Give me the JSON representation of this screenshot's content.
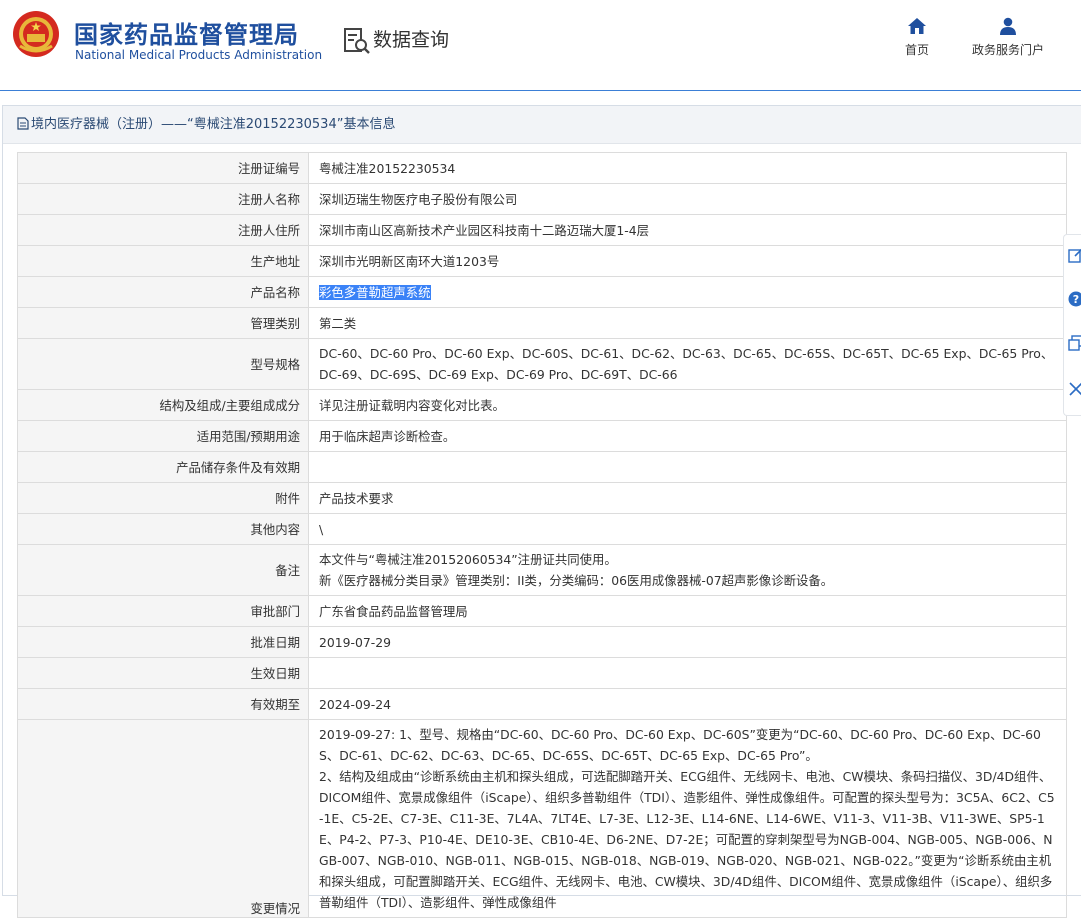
{
  "header": {
    "logo_cn": "国家药品监督管理局",
    "logo_en": "National Medical Products Administration",
    "query_title": "数据查询",
    "nav": [
      {
        "label": "首页",
        "icon": "home-icon"
      },
      {
        "label": "政务服务门户",
        "icon": "user-icon"
      }
    ]
  },
  "breadcrumb": "境内医疗器械（注册）——“粤械注准20152230534”基本信息",
  "rows": [
    {
      "key": "注册证编号",
      "value": "粤械注准20152230534"
    },
    {
      "key": "注册人名称",
      "value": "深圳迈瑞生物医疗电子股份有限公司"
    },
    {
      "key": "注册人住所",
      "value": "深圳市南山区高新技术产业园区科技南十二路迈瑞大厦1-4层"
    },
    {
      "key": "生产地址",
      "value": "深圳市光明新区南环大道1203号"
    },
    {
      "key": "产品名称",
      "value": "彩色多普勒超声系统"
    },
    {
      "key": "管理类别",
      "value": "第二类"
    },
    {
      "key": "型号规格",
      "value": "DC-60、DC-60 Pro、DC-60 Exp、DC-60S、DC-61、DC-62、DC-63、DC-65、DC-65S、DC-65T、DC-65 Exp、DC-65 Pro、DC-69、DC-69S、DC-69 Exp、DC-69 Pro、DC-69T、DC-66"
    },
    {
      "key": "结构及组成/主要组成成分",
      "value": "详见注册证载明内容变化对比表。"
    },
    {
      "key": "适用范围/预期用途",
      "value": "用于临床超声诊断检查。"
    },
    {
      "key": "产品储存条件及有效期",
      "value": ""
    },
    {
      "key": "附件",
      "value": "产品技术要求"
    },
    {
      "key": "其他内容",
      "value": "\\"
    },
    {
      "key": "备注",
      "value_line1": "本文件与“粤械注准20152060534”注册证共同使用。",
      "value_line2": "新《医疗器械分类目录》管理类别：II类，分类编码：06医用成像器械-07超声影像诊断设备。"
    },
    {
      "key": "审批部门",
      "value": "广东省食品药品监督管理局"
    },
    {
      "key": "批准日期",
      "value": "2019-07-29"
    },
    {
      "key": "生效日期",
      "value": ""
    },
    {
      "key": "有效期至",
      "value": "2024-09-24"
    },
    {
      "key": "变更情况",
      "value_line1": "2019-09-27: 1、型号、规格由“DC-60、DC-60 Pro、DC-60 Exp、DC-60S”变更为“DC-60、DC-60 Pro、DC-60 Exp、DC-60S、DC-61、DC-62、DC-63、DC-65、DC-65S、DC-65T、DC-65 Exp、DC-65 Pro”。",
      "value_line2": "2、结构及组成由“诊断系统由主机和探头组成，可选配脚踏开关、ECG组件、无线网卡、电池、CW模块、条码扫描仪、3D/4D组件、DICOM组件、宽景成像组件（iScape）、组织多普勒组件（TDI）、造影组件、弹性成像组件。可配置的探头型号为：3C5A、6C2、C5-1E、C5-2E、C7-3E、C11-3E、7L4A、7LT4E、L7-3E、L12-3E、L14-6NE、L14-6WE、V11-3、V11-3B、V11-3WE、SP5-1E、P4-2、P7-3、P10-4E、DE10-3E、CB10-4E、D6-2NE、D7-2E；可配置的穿刺架型号为NGB-004、NGB-005、NGB-006、NGB-007、NGB-010、NGB-011、NGB-015、NGB-018、NGB-019、NGB-020、NGB-021、NGB-022。”变更为“诊断系统由主机和探头组成，可配置脚踏开关、ECG组件、无线网卡、电池、CW模块、3D/4D组件、DICOM组件、宽景成像组件（iScape）、组织多普勒组件（TDI）、造影组件、弹性成像组件"
    }
  ],
  "colors": {
    "brand_blue": "#1f4f9e",
    "highlight": "#3a82f7",
    "key_bg": "#f5f5f5"
  }
}
